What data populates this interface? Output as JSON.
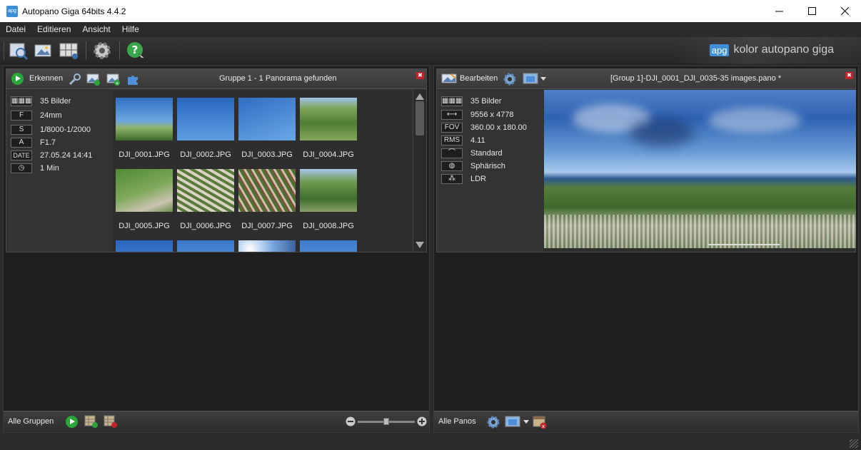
{
  "window": {
    "title": "Autopano Giga 64bits 4.4.2",
    "icon_text": "apg"
  },
  "menu": [
    "Datei",
    "Editieren",
    "Ansicht",
    "Hilfe"
  ],
  "brand": {
    "badge": "apg",
    "text": "kolor autopano giga"
  },
  "group_panel": {
    "detect_label": "Erkennen",
    "title": "Gruppe 1 - 1 Panorama gefunden",
    "info": [
      {
        "badge": "▦▦▦",
        "value": "35 Bilder"
      },
      {
        "badge": "F",
        "value": "24mm"
      },
      {
        "badge": "S",
        "value": "1/8000-1/2000"
      },
      {
        "badge": "A",
        "value": "F1.7"
      },
      {
        "badge": "DATE",
        "value": "27.05.24 14:41"
      },
      {
        "badge": "◷",
        "value": "1 Min"
      }
    ],
    "thumbnails": [
      "DJI_0001.JPG",
      "DJI_0002.JPG",
      "DJI_0003.JPG",
      "DJI_0004.JPG",
      "DJI_0005.JPG",
      "DJI_0006.JPG",
      "DJI_0007.JPG",
      "DJI_0008.JPG"
    ]
  },
  "pano_panel": {
    "edit_label": "Bearbeiten",
    "title": "[Group 1]-DJI_0001_DJI_0035-35 images.pano *",
    "info": [
      {
        "badge": "▦▦▦",
        "value": "35 Bilder"
      },
      {
        "badge": "⟷",
        "value": "9556 x 4778"
      },
      {
        "badge": "FOV",
        "value": "360.00 x 180.00"
      },
      {
        "badge": "RMS",
        "value": "4.11"
      },
      {
        "badge": "⌒",
        "value": "Standard"
      },
      {
        "badge": "◍",
        "value": "Sphärisch"
      },
      {
        "badge": "⁂",
        "value": "LDR"
      }
    ]
  },
  "footer_left": {
    "label": "Alle Gruppen"
  },
  "footer_right": {
    "label": "Alle Panos"
  },
  "colors": {
    "accent_green": "#2aa63a",
    "accent_blue": "#3f8fd6",
    "close_red": "#c0262c"
  }
}
